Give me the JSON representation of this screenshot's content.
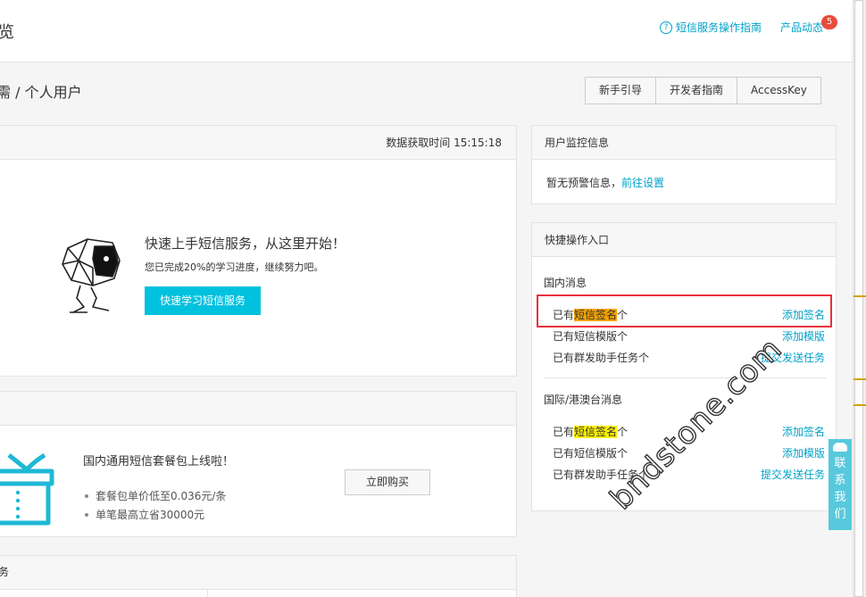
{
  "header": {
    "title": "览",
    "guide_icon": "?",
    "guide_label": "短信服务操作指南",
    "news_label": "产品动态",
    "news_badge": "5"
  },
  "breadcrumb": "需 / 个人用户",
  "toolbar": {
    "beginner_guide": "新手引导",
    "dev_guide": "开发者指南",
    "access_key": "AccessKey"
  },
  "learn_panel": {
    "fetch_time_label": "数据获取时间 15:15:18",
    "title": "快速上手短信服务，从这里开始！",
    "progress": "您已完成20%的学习进度，继续努力吧。",
    "button": "快速学习短信服务"
  },
  "package_panel": {
    "title": "国内通用短信套餐包上线啦！",
    "bullets": [
      "套餐包单价低至0.036元/条",
      "单笔最高立省30000元"
    ],
    "buy_button": "立即购买"
  },
  "service_panel": {
    "title": "务"
  },
  "monitor_panel": {
    "title": "用户监控信息",
    "text": "暂无预警信息，",
    "link": "前往设置"
  },
  "quick_panel": {
    "title": "快捷操作入口",
    "domestic": {
      "section": "国内消息",
      "rows": [
        {
          "pre": "已有",
          "hl": "短信签名",
          "post": "个",
          "action": "添加签名"
        },
        {
          "pre": "已有短信模版个",
          "hl": "",
          "post": "",
          "action": "添加模版"
        },
        {
          "pre": "已有群发助手任务个",
          "hl": "",
          "post": "",
          "action": "提交发送任务"
        }
      ]
    },
    "international": {
      "section": "国际/港澳台消息",
      "rows": [
        {
          "pre": "已有",
          "hl": "短信签名",
          "post": "个",
          "action": "添加签名"
        },
        {
          "pre": "已有短信模版个",
          "hl": "",
          "post": "",
          "action": "添加模版"
        },
        {
          "pre": "已有群发助手任务个",
          "hl": "",
          "post": "",
          "action": "提交发送任务"
        }
      ]
    }
  },
  "contact": [
    "联",
    "系",
    "我",
    "们"
  ],
  "watermark": "bndstone.com",
  "colors": {
    "accent": "#00a2ca",
    "primary_button": "#00c1de",
    "badge": "#e74c3c",
    "highlight_box": "#e8313b",
    "highlight_orange": "#f5a300",
    "highlight_yellow": "#fff200"
  }
}
